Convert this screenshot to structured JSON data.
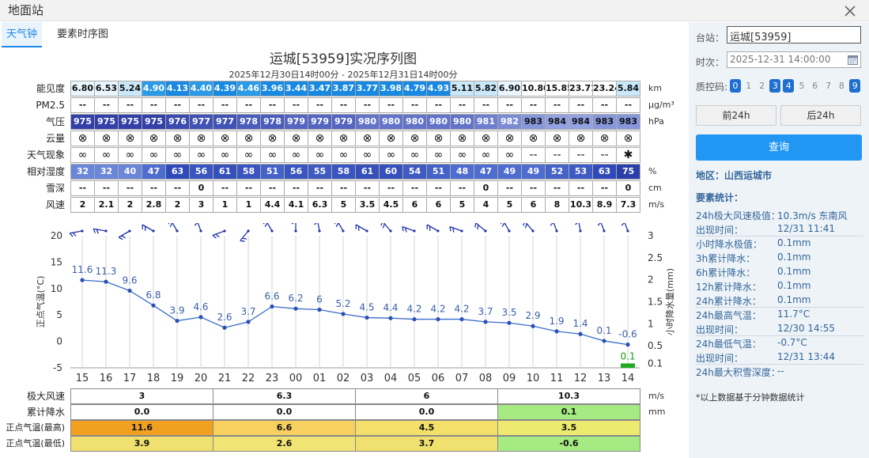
{
  "window": {
    "title": "地面站"
  },
  "tabs": [
    "天气钟",
    "要素时序图"
  ],
  "chart": {
    "title": "运城[53959]实况序列图",
    "subtitle": "2025年12月30日14时00分 - 2025年12月31日14时00分"
  },
  "grid": {
    "rows": [
      {
        "label": "能见度",
        "unit": "km",
        "values": [
          "6.80",
          "6.53",
          "5.24",
          "4.90",
          "4.13",
          "4.40",
          "4.39",
          "4.46",
          "3.96",
          "3.44",
          "3.47",
          "3.87",
          "3.77",
          "3.98",
          "4.79",
          "4.93",
          "5.11",
          "5.82",
          "6.90",
          "10.80",
          "15.85",
          "23.71",
          "23.24",
          "5.84"
        ],
        "colors": [
          "#eaf6ff",
          "#eaf6ff",
          "#c9e9fb",
          "#2b9be8",
          "#1789e2",
          "#2b9be8",
          "#1789e2",
          "#2b9be8",
          "#1789e2",
          "#1789e2",
          "#1789e2",
          "#1789e2",
          "#1789e2",
          "#1789e2",
          "#1789e2",
          "#1789e2",
          "#c9e9fb",
          "#c9e9fb",
          "#eaf6ff",
          "#ffffff",
          "#ffffff",
          "#ffffff",
          "#ffffff",
          "#c9e9fb"
        ]
      },
      {
        "label": "PM2.5",
        "unit": "μg/m³",
        "values": [
          "--",
          "--",
          "--",
          "--",
          "--",
          "--",
          "--",
          "--",
          "--",
          "--",
          "--",
          "--",
          "--",
          "--",
          "--",
          "--",
          "--",
          "--",
          "--",
          "--",
          "--",
          "--",
          "--",
          "--"
        ]
      },
      {
        "label": "气压",
        "unit": "hPa",
        "values": [
          "975",
          "975",
          "975",
          "975",
          "976",
          "977",
          "977",
          "978",
          "978",
          "979",
          "979",
          "979",
          "980",
          "980",
          "980",
          "980",
          "980",
          "981",
          "982",
          "983",
          "984",
          "984",
          "983",
          "983"
        ],
        "colors": [
          "#3340a8",
          "#3340a8",
          "#3340a8",
          "#3340a8",
          "#3a4aaf",
          "#4052b5",
          "#4052b5",
          "#4a5dbc",
          "#4a5dbc",
          "#5566c2",
          "#5566c2",
          "#5566c2",
          "#6273c9",
          "#6273c9",
          "#6273c9",
          "#6273c9",
          "#6273c9",
          "#6e7fd0",
          "#7b8bd6",
          "#8797dc",
          "#93a2e2",
          "#93a2e2",
          "#8797dc",
          "#8797dc"
        ]
      },
      {
        "label": "云量",
        "unit": "",
        "values": [
          "⊗",
          "⊗",
          "⊗",
          "⊗",
          "⊗",
          "⊗",
          "⊗",
          "⊗",
          "⊗",
          "⊗",
          "⊗",
          "⊗",
          "⊗",
          "⊗",
          "⊗",
          "⊗",
          "⊗",
          "⊗",
          "⊗",
          "⊗",
          "⊗",
          "⊗",
          "⊗",
          "⊗"
        ]
      },
      {
        "label": "天气现象",
        "unit": "",
        "values": [
          "∞",
          "∞",
          "∞",
          "∞",
          "∞",
          "∞",
          "∞",
          "∞",
          "∞",
          "∞",
          "∞",
          "∞",
          "∞",
          "∞",
          "∞",
          "∞",
          "∞",
          "∞",
          "∞",
          "--",
          "--",
          "--",
          "--",
          "✱"
        ]
      },
      {
        "label": "相对湿度",
        "unit": "%",
        "values": [
          "32",
          "32",
          "40",
          "47",
          "63",
          "56",
          "61",
          "58",
          "51",
          "56",
          "55",
          "58",
          "61",
          "60",
          "54",
          "51",
          "48",
          "47",
          "49",
          "49",
          "52",
          "53",
          "63",
          "75"
        ],
        "colors": [
          "#6a86d8",
          "#6a86d8",
          "#6a86d8",
          "#4f6cd0",
          "#2f4ab8",
          "#3a55bf",
          "#3550bb",
          "#3a55bf",
          "#4562c8",
          "#3a55bf",
          "#3f5ac3",
          "#3a55bf",
          "#3550bb",
          "#3550bb",
          "#3f5ac3",
          "#4562c8",
          "#4f6cd0",
          "#4f6cd0",
          "#4f6cd0",
          "#4f6cd0",
          "#4562c8",
          "#3f5ac3",
          "#2f4ab8",
          "#2a3fa8"
        ]
      },
      {
        "label": "雪深",
        "unit": "cm",
        "values": [
          "--",
          "--",
          "--",
          "--",
          "--",
          "0",
          "--",
          "--",
          "--",
          "--",
          "--",
          "--",
          "--",
          "--",
          "--",
          "--",
          "--",
          "0",
          "--",
          "--",
          "--",
          "--",
          "--",
          "0"
        ]
      },
      {
        "label": "风速",
        "unit": "m/s",
        "values": [
          "2",
          "2.1",
          "2",
          "2.8",
          "2",
          "3",
          "1",
          "1",
          "4.4",
          "4.1",
          "6.3",
          "5",
          "3.5",
          "4.5",
          "6",
          "6",
          "5",
          "4",
          "5",
          "6",
          "8",
          "10.3",
          "8.9",
          "7.3"
        ]
      }
    ]
  },
  "chart_data": {
    "type": "line",
    "x": [
      "15",
      "16",
      "17",
      "18",
      "19",
      "20",
      "21",
      "22",
      "23",
      "00",
      "01",
      "02",
      "03",
      "04",
      "05",
      "06",
      "07",
      "08",
      "09",
      "10",
      "11",
      "12",
      "13",
      "14"
    ],
    "series": [
      {
        "values": [
          11.6,
          11.3,
          9.6,
          6.8,
          3.9,
          4.6,
          2.6,
          3.7,
          6.6,
          6.2,
          6,
          5.2,
          4.5,
          4.4,
          4.2,
          4.2,
          4.2,
          3.7,
          3.5,
          2.9,
          1.9,
          1.4,
          0.1,
          -0.6
        ],
        "color": "#3a6cc8"
      },
      {
        "values": [
          0,
          0,
          0,
          0,
          0,
          0,
          0,
          0,
          0,
          0,
          0,
          0,
          0,
          0,
          0,
          0,
          0,
          0,
          0,
          0,
          0,
          0,
          0,
          0.1
        ],
        "color": "#1faa1f"
      }
    ],
    "ylabel": "正点气温(°C)",
    "y2label": "小时降水量(mm)",
    "ylim": [
      -5,
      20
    ],
    "y2lim": [
      0,
      3
    ],
    "yticks": [
      "-5",
      "0",
      "5",
      "10",
      "15",
      "20"
    ],
    "y2ticks": [
      "0.1",
      "0.5",
      "1",
      "1.5",
      "2",
      "2.5",
      "3"
    ]
  },
  "summary": {
    "rows": [
      {
        "label": "极大风速",
        "unit": "m/s",
        "values": [
          "3",
          "6.3",
          "6",
          "10.3"
        ],
        "colors": [
          "#ffffff",
          "#ffffff",
          "#ffffff",
          "#ffffff"
        ]
      },
      {
        "label": "累计降水",
        "unit": "mm",
        "values": [
          "0.0",
          "0.0",
          "0.0",
          "0.1"
        ],
        "colors": [
          "#ffffff",
          "#ffffff",
          "#ffffff",
          "#a6ea84"
        ]
      },
      {
        "label": "正点气温(最高)",
        "unit": "",
        "values": [
          "11.6",
          "6.6",
          "4.5",
          "3.5"
        ],
        "colors": [
          "#f2a020",
          "#f7d060",
          "#f3e06a",
          "#eeea70"
        ]
      },
      {
        "label": "正点气温(最低)",
        "unit": "",
        "values": [
          "3.9",
          "2.6",
          "3.7",
          "-0.6"
        ],
        "colors": [
          "#f0e070",
          "#efe474",
          "#f0e070",
          "#a6ea84"
        ]
      }
    ]
  },
  "side": {
    "station_label": "台站：",
    "station_value": "运城[53959]",
    "time_label": "时次：",
    "time_value": "2025-12-31 14:00:00",
    "qc_label": "质控码:",
    "qc": [
      "0",
      "1",
      "2",
      "3",
      "4",
      "5",
      "6",
      "7",
      "8",
      "9"
    ],
    "qc_active": [
      true,
      false,
      false,
      true,
      true,
      false,
      false,
      false,
      false,
      true
    ],
    "prev_label": "前24h",
    "next_label": "后24h",
    "query_label": "查询",
    "region": "地区：山西运城市",
    "stats_title": "要素统计：",
    "stats": [
      {
        "k": "24h极大风速极值：",
        "v": "10.3m/s 东南风"
      },
      {
        "k": "出现时间：",
        "v": "12/31 11:41"
      },
      {
        "k": "小时降水极值：",
        "v": "0.1mm"
      },
      {
        "k": "3h累计降水：",
        "v": "0.1mm"
      },
      {
        "k": "6h累计降水：",
        "v": "0.1mm"
      },
      {
        "k": "12h累计降水：",
        "v": "0.1mm"
      },
      {
        "k": "24h累计降水：",
        "v": "0.1mm"
      },
      {
        "k": "24h最高气温：",
        "v": "11.7°C"
      },
      {
        "k": "出现时间：",
        "v": "12/30 14:55"
      },
      {
        "k": "24h最低气温：",
        "v": "-0.7°C"
      },
      {
        "k": "出现时间：",
        "v": "12/31 13:44"
      },
      {
        "k": "24h最大积雪深度：",
        "v": "--"
      }
    ],
    "note": "*以上数据基于分钟数据统计"
  }
}
